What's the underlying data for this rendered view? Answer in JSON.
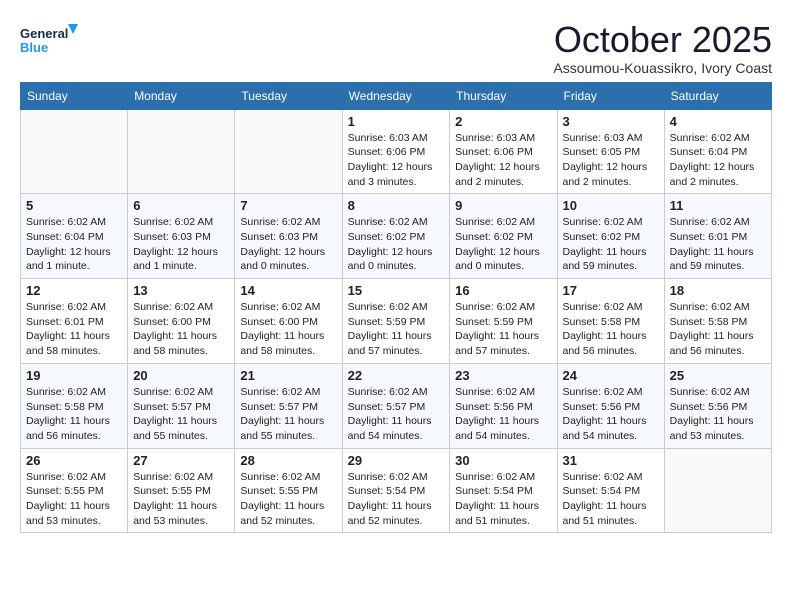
{
  "logo": {
    "line1": "General",
    "line2": "Blue"
  },
  "title": "October 2025",
  "location": "Assoumou-Kouassikro, Ivory Coast",
  "days_header": [
    "Sunday",
    "Monday",
    "Tuesday",
    "Wednesday",
    "Thursday",
    "Friday",
    "Saturday"
  ],
  "weeks": [
    [
      {
        "day": "",
        "info": ""
      },
      {
        "day": "",
        "info": ""
      },
      {
        "day": "",
        "info": ""
      },
      {
        "day": "1",
        "info": "Sunrise: 6:03 AM\nSunset: 6:06 PM\nDaylight: 12 hours and 3 minutes."
      },
      {
        "day": "2",
        "info": "Sunrise: 6:03 AM\nSunset: 6:06 PM\nDaylight: 12 hours and 2 minutes."
      },
      {
        "day": "3",
        "info": "Sunrise: 6:03 AM\nSunset: 6:05 PM\nDaylight: 12 hours and 2 minutes."
      },
      {
        "day": "4",
        "info": "Sunrise: 6:02 AM\nSunset: 6:04 PM\nDaylight: 12 hours and 2 minutes."
      }
    ],
    [
      {
        "day": "5",
        "info": "Sunrise: 6:02 AM\nSunset: 6:04 PM\nDaylight: 12 hours and 1 minute."
      },
      {
        "day": "6",
        "info": "Sunrise: 6:02 AM\nSunset: 6:03 PM\nDaylight: 12 hours and 1 minute."
      },
      {
        "day": "7",
        "info": "Sunrise: 6:02 AM\nSunset: 6:03 PM\nDaylight: 12 hours and 0 minutes."
      },
      {
        "day": "8",
        "info": "Sunrise: 6:02 AM\nSunset: 6:02 PM\nDaylight: 12 hours and 0 minutes."
      },
      {
        "day": "9",
        "info": "Sunrise: 6:02 AM\nSunset: 6:02 PM\nDaylight: 12 hours and 0 minutes."
      },
      {
        "day": "10",
        "info": "Sunrise: 6:02 AM\nSunset: 6:02 PM\nDaylight: 11 hours and 59 minutes."
      },
      {
        "day": "11",
        "info": "Sunrise: 6:02 AM\nSunset: 6:01 PM\nDaylight: 11 hours and 59 minutes."
      }
    ],
    [
      {
        "day": "12",
        "info": "Sunrise: 6:02 AM\nSunset: 6:01 PM\nDaylight: 11 hours and 58 minutes."
      },
      {
        "day": "13",
        "info": "Sunrise: 6:02 AM\nSunset: 6:00 PM\nDaylight: 11 hours and 58 minutes."
      },
      {
        "day": "14",
        "info": "Sunrise: 6:02 AM\nSunset: 6:00 PM\nDaylight: 11 hours and 58 minutes."
      },
      {
        "day": "15",
        "info": "Sunrise: 6:02 AM\nSunset: 5:59 PM\nDaylight: 11 hours and 57 minutes."
      },
      {
        "day": "16",
        "info": "Sunrise: 6:02 AM\nSunset: 5:59 PM\nDaylight: 11 hours and 57 minutes."
      },
      {
        "day": "17",
        "info": "Sunrise: 6:02 AM\nSunset: 5:58 PM\nDaylight: 11 hours and 56 minutes."
      },
      {
        "day": "18",
        "info": "Sunrise: 6:02 AM\nSunset: 5:58 PM\nDaylight: 11 hours and 56 minutes."
      }
    ],
    [
      {
        "day": "19",
        "info": "Sunrise: 6:02 AM\nSunset: 5:58 PM\nDaylight: 11 hours and 56 minutes."
      },
      {
        "day": "20",
        "info": "Sunrise: 6:02 AM\nSunset: 5:57 PM\nDaylight: 11 hours and 55 minutes."
      },
      {
        "day": "21",
        "info": "Sunrise: 6:02 AM\nSunset: 5:57 PM\nDaylight: 11 hours and 55 minutes."
      },
      {
        "day": "22",
        "info": "Sunrise: 6:02 AM\nSunset: 5:57 PM\nDaylight: 11 hours and 54 minutes."
      },
      {
        "day": "23",
        "info": "Sunrise: 6:02 AM\nSunset: 5:56 PM\nDaylight: 11 hours and 54 minutes."
      },
      {
        "day": "24",
        "info": "Sunrise: 6:02 AM\nSunset: 5:56 PM\nDaylight: 11 hours and 54 minutes."
      },
      {
        "day": "25",
        "info": "Sunrise: 6:02 AM\nSunset: 5:56 PM\nDaylight: 11 hours and 53 minutes."
      }
    ],
    [
      {
        "day": "26",
        "info": "Sunrise: 6:02 AM\nSunset: 5:55 PM\nDaylight: 11 hours and 53 minutes."
      },
      {
        "day": "27",
        "info": "Sunrise: 6:02 AM\nSunset: 5:55 PM\nDaylight: 11 hours and 53 minutes."
      },
      {
        "day": "28",
        "info": "Sunrise: 6:02 AM\nSunset: 5:55 PM\nDaylight: 11 hours and 52 minutes."
      },
      {
        "day": "29",
        "info": "Sunrise: 6:02 AM\nSunset: 5:54 PM\nDaylight: 11 hours and 52 minutes."
      },
      {
        "day": "30",
        "info": "Sunrise: 6:02 AM\nSunset: 5:54 PM\nDaylight: 11 hours and 51 minutes."
      },
      {
        "day": "31",
        "info": "Sunrise: 6:02 AM\nSunset: 5:54 PM\nDaylight: 11 hours and 51 minutes."
      },
      {
        "day": "",
        "info": ""
      }
    ]
  ]
}
